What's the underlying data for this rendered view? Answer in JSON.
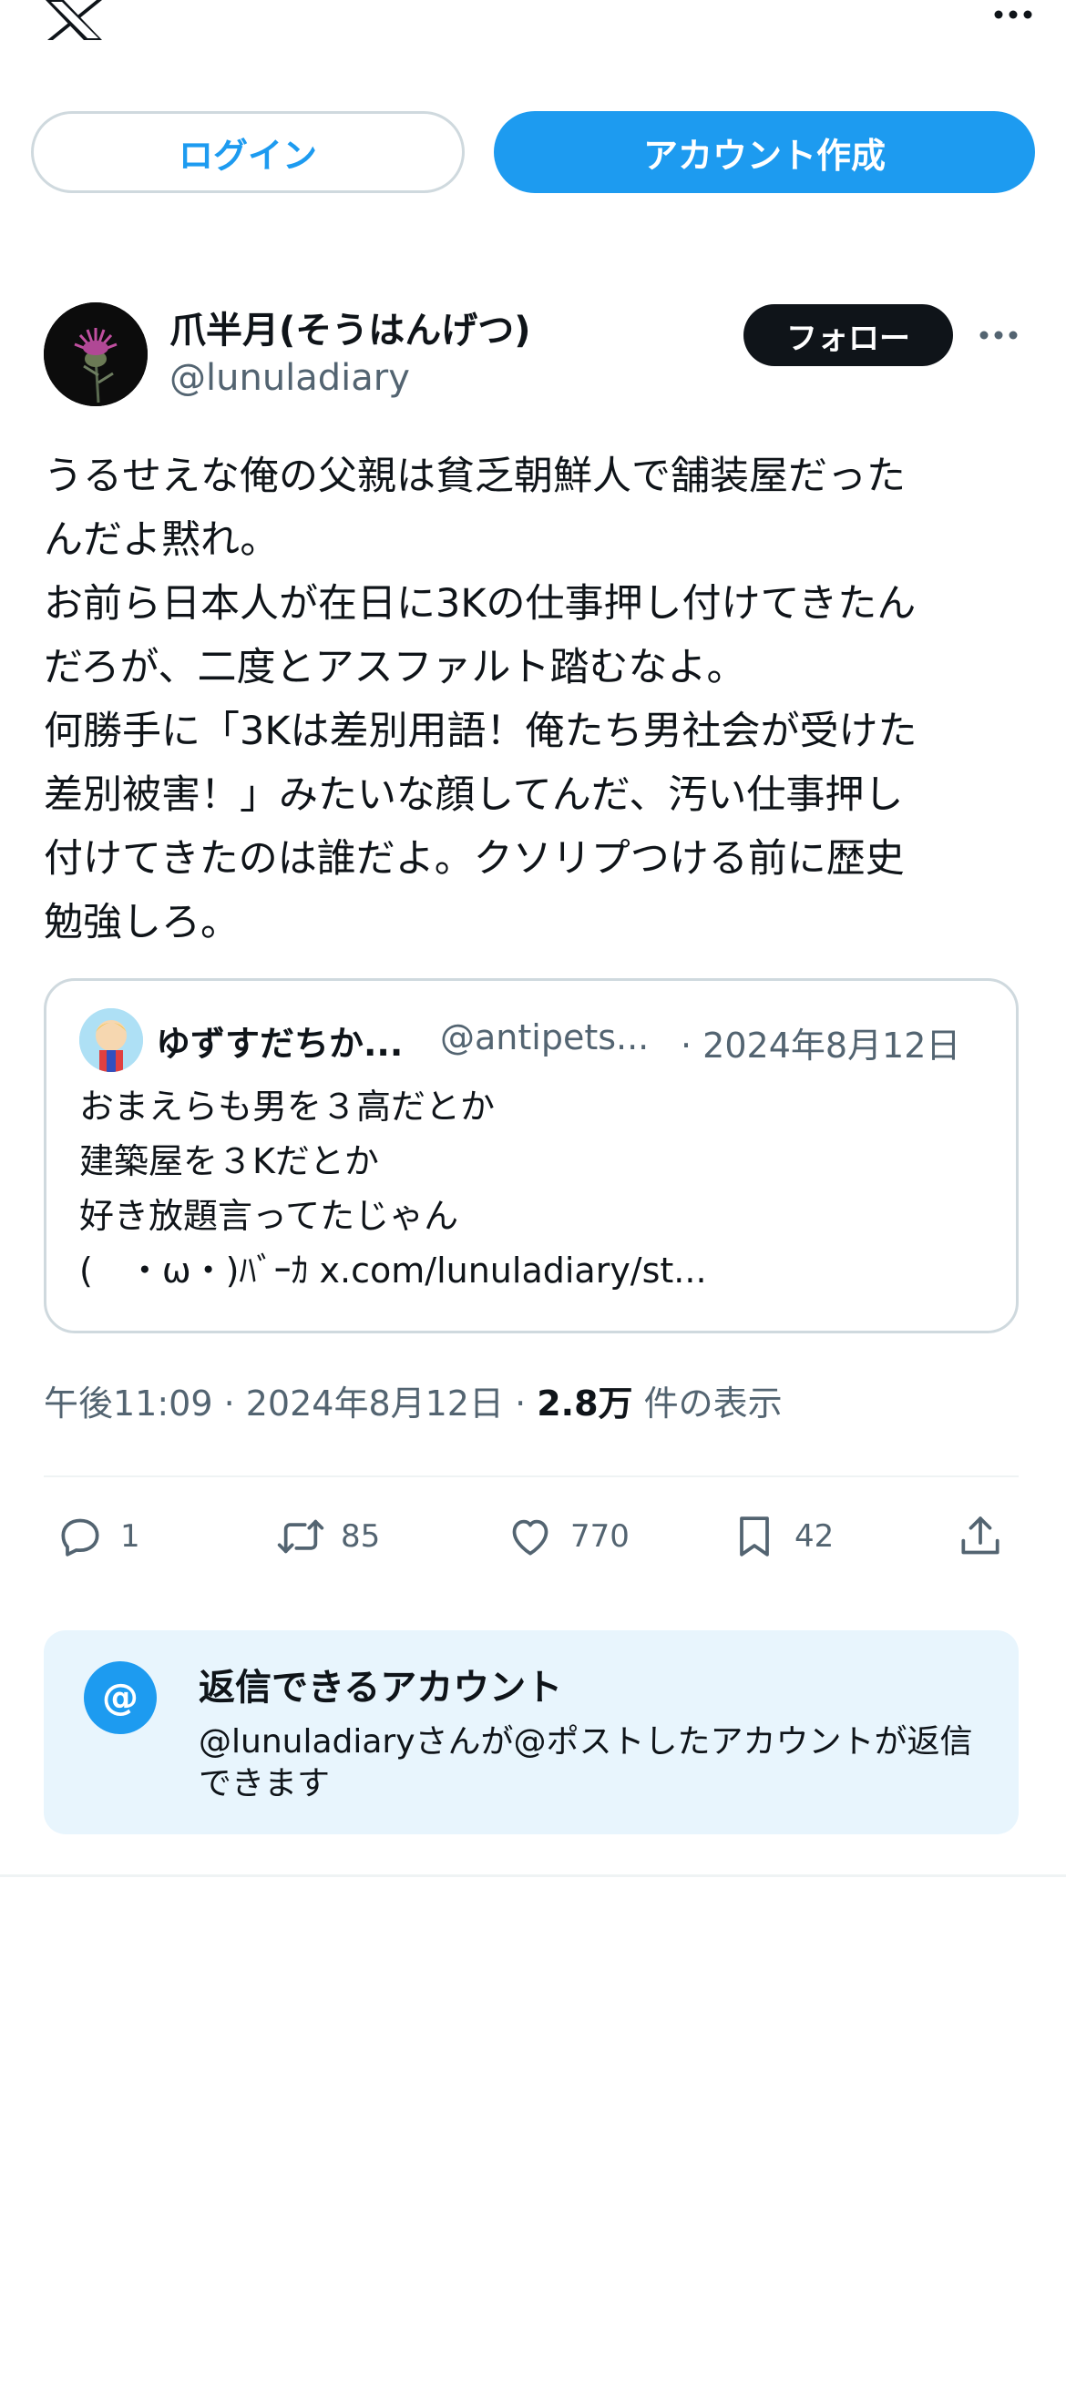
{
  "header": {
    "logo": "x-logo-icon",
    "more": "more-icon"
  },
  "auth": {
    "login_label": "ログイン",
    "signup_label": "アカウント作成"
  },
  "author": {
    "name": "爪半月(そうはんげつ)",
    "handle": "@lunuladiary",
    "follow_label": "フォロー"
  },
  "post": {
    "text": "うるせえな俺の父親は貧乏朝鮮人で舗装屋だった\nんだよ黙れ。\nお前ら日本人が在日に3Kの仕事押し付けてきたん\nだろが、二度とアスファルト踏むなよ。\n何勝手に「3Kは差別用語！俺たち男社会が受けた\n差別被害！」みたいな顔してんだ、汚い仕事押し\n付けてきたのは誰だよ。クソリプつける前に歴史\n勉強しろ。"
  },
  "quote": {
    "name": "ゆずすだちか...",
    "handle": "@antipets...",
    "date": "· 2024年8月12日",
    "text": "おまえらも男を３高だとか\n建築屋を３Kだとか\n好き放題言ってたじゃん\n(　・ω・)ﾊﾞｰｶ x.com/lunuladiary/st..."
  },
  "meta": {
    "time": "午後11:09 · 2024年8月12日 · ",
    "views": "2.8万",
    "views_suffix": " 件の表示"
  },
  "actions": {
    "reply_count": "1",
    "retweet_count": "85",
    "like_count": "770",
    "bookmark_count": "42"
  },
  "reply_restriction": {
    "icon": "@",
    "title": "返信できるアカウント",
    "description": "@lunuladiaryさんが@ポストしたアカウントが返信できます"
  },
  "colors": {
    "accent": "#1d9bf0",
    "text": "#0f1419",
    "secondary": "#536471",
    "border": "#cfd9de",
    "reply_bg": "#e8f5fd"
  }
}
